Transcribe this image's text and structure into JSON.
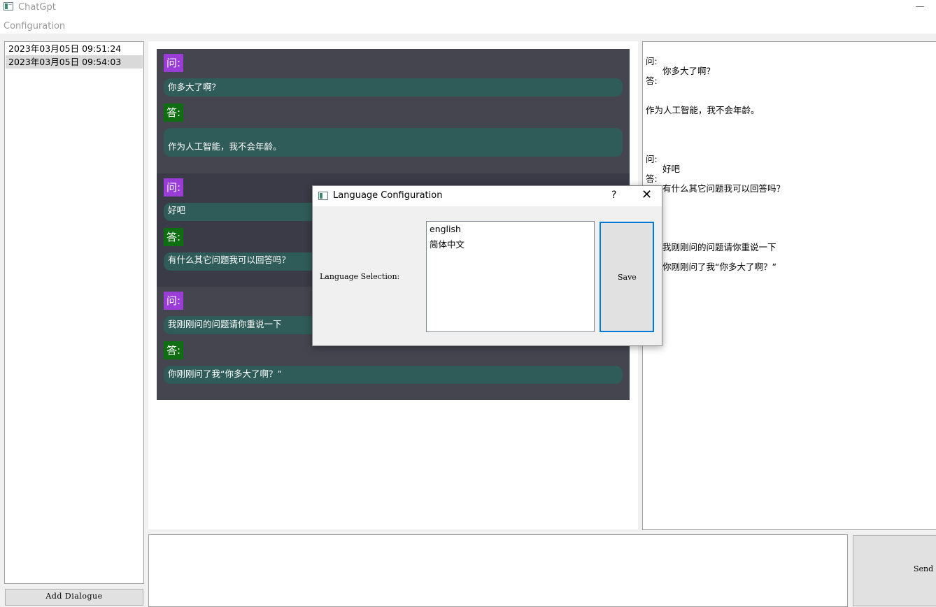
{
  "window": {
    "title": "ChatGpt",
    "minimize_glyph": "—"
  },
  "menu": {
    "configuration": "Configuration"
  },
  "sidebar": {
    "items": [
      {
        "label": "2023年03月05日 09:51:24",
        "selected": false
      },
      {
        "label": "2023年03月05日 09:54:03",
        "selected": true
      }
    ],
    "add_button": "Add Dialogue"
  },
  "chat": {
    "question_tag": "问:",
    "answer_tag": "答:",
    "exchanges": [
      {
        "question": "你多大了啊？",
        "answer": "作为人工智能，我不会年龄。"
      },
      {
        "question": "好吧",
        "answer": "有什么其它问题我可以回答吗？"
      },
      {
        "question": "我刚刚问的问题请你重说一下",
        "answer": "你刚刚问了我“你多大了啊？”"
      }
    ]
  },
  "transcript": {
    "q_label": "问:",
    "a_label": "答:",
    "q1": "你多大了啊？",
    "a1": "作为人工智能，我不会年龄。",
    "q2": "好吧",
    "a2": "有什么其它问题我可以回答吗？",
    "q3": "我刚刚问的问题请你重说一下",
    "a3": "你刚刚问了我“你多大了啊？”"
  },
  "input": {
    "value": "",
    "send_label": "Send"
  },
  "dialog": {
    "title": "Language Configuration",
    "help": "?",
    "close": "✕",
    "label": "Language Selection:",
    "options": [
      "english",
      "简体中文"
    ],
    "save": "Save"
  },
  "colors": {
    "question_tag": "#9a3cd6",
    "answer_tag": "#0f6e12",
    "bubble": "#2f5c58",
    "chat_bg": "#454550",
    "focus": "#0078d7"
  }
}
